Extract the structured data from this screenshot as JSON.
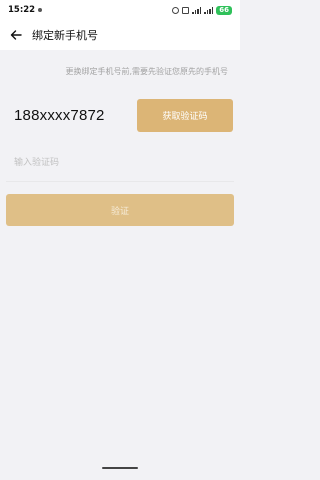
{
  "status_bar": {
    "time": "15:22",
    "battery": "66"
  },
  "header": {
    "title": "绑定新手机号",
    "back_icon": "arrow-left-icon"
  },
  "main": {
    "hint": "更换绑定手机号前,需要先验证您原先的手机号",
    "phone_number": "188xxxx7872",
    "get_code_label": "获取验证码",
    "code_input": {
      "placeholder": "输入验证码",
      "value": ""
    },
    "verify_label": "验证"
  },
  "colors": {
    "accent": "#dcb576",
    "verify_disabled": "#dfbf87",
    "background": "#f2f2f5"
  }
}
